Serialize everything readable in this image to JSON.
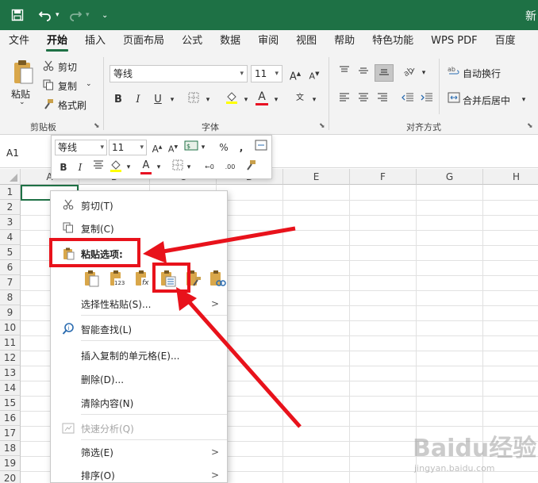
{
  "titlebar": {
    "title_fragment": "新"
  },
  "tabs": [
    "文件",
    "开始",
    "插入",
    "页面布局",
    "公式",
    "数据",
    "审阅",
    "视图",
    "帮助",
    "特色功能",
    "WPS PDF",
    "百度"
  ],
  "ribbon": {
    "clipboard": {
      "paste": "粘贴",
      "cut": "剪切",
      "copy": "复制",
      "format_painter": "格式刷",
      "group_label": "剪贴板"
    },
    "font": {
      "font_name": "等线",
      "font_size": "11",
      "bold": "B",
      "italic": "I",
      "underline": "U",
      "group_label": "字体"
    },
    "alignment": {
      "wrap_text": "自动换行",
      "merge_center": "合并后居中",
      "group_label": "对齐方式"
    }
  },
  "formula_bar": {
    "name_box": "A1"
  },
  "sheet": {
    "columns": [
      "A",
      "B",
      "C",
      "D",
      "E",
      "F",
      "G",
      "H"
    ],
    "rows": [
      "1",
      "2",
      "3",
      "4",
      "5",
      "6",
      "7",
      "8",
      "9",
      "10",
      "11",
      "12",
      "13",
      "14",
      "15",
      "16",
      "17",
      "18",
      "19",
      "20"
    ]
  },
  "mini_toolbar": {
    "font_name": "等线",
    "font_size": "11",
    "percent": "%",
    "comma": ",",
    "bold": "B",
    "italic": "I",
    "dec_increase": "←0",
    "dec_decrease": ".00"
  },
  "context_menu": {
    "cut": "剪切(T)",
    "copy": "复制(C)",
    "paste_options": "粘贴选项:",
    "paste_special": "选择性粘贴(S)...",
    "smart_lookup": "智能查找(L)",
    "insert_copied": "插入复制的单元格(E)...",
    "delete": "删除(D)...",
    "clear_contents": "清除内容(N)",
    "quick_analysis": "快速分析(Q)",
    "filter": "筛选(E)",
    "sort": "排序(O)"
  },
  "watermark": {
    "text": "Baidu经验",
    "sub": "jingyan.baidu.com"
  },
  "colors": {
    "excel_green": "#1e7145",
    "annotation_red": "#e8121b"
  }
}
